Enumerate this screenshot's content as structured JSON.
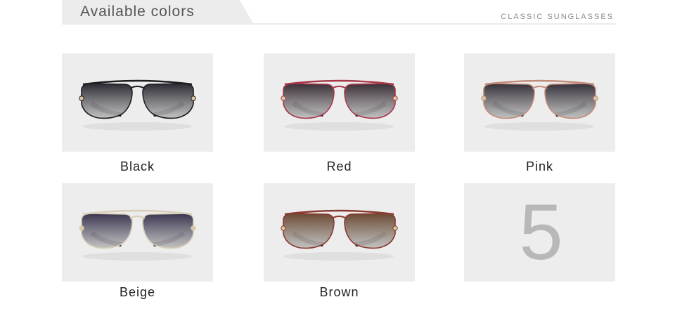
{
  "header": {
    "title": "Available colors",
    "subtitle": "CLASSIC SUNGLASSES"
  },
  "variants": [
    {
      "label": "Black",
      "frame_color": "#1e1e22",
      "lens_color": "#2c2b33",
      "temple_color": "#111114"
    },
    {
      "label": "Red",
      "frame_color": "#a8384a",
      "lens_color": "#3a3038",
      "temple_color": "#1a1416"
    },
    {
      "label": "Pink",
      "frame_color": "#c28a7a",
      "lens_color": "#35313a",
      "temple_color": "#151316"
    },
    {
      "label": "Beige",
      "frame_color": "#d8cdb8",
      "lens_color": "#3b3550",
      "temple_color": "#161419"
    },
    {
      "label": "Brown",
      "frame_color": "#8a3a2e",
      "lens_color": "#6b4a34",
      "temple_color": "#1a1412"
    }
  ],
  "count_tile": {
    "value": "5"
  }
}
